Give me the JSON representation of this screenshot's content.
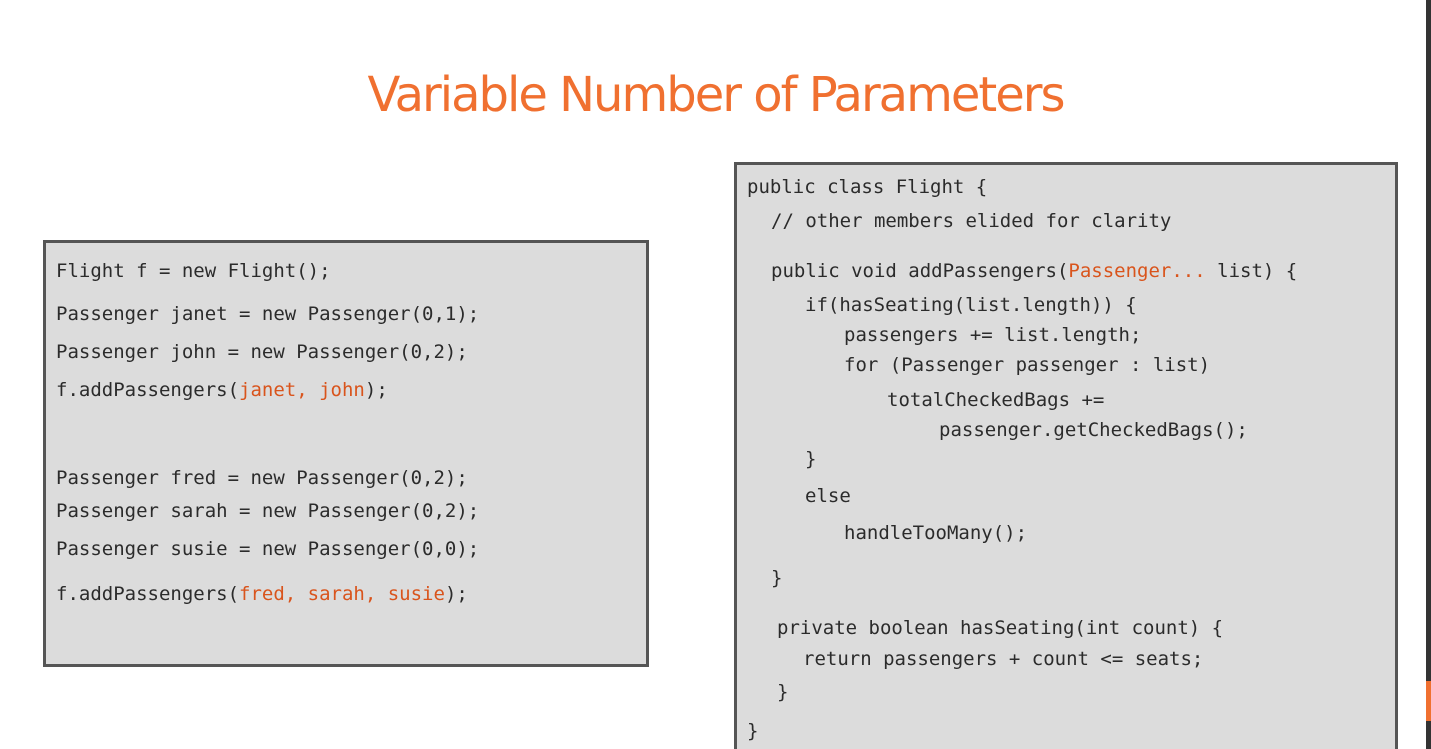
{
  "title": "Variable Number of Parameters",
  "colors": {
    "accent": "#f07030",
    "highlight": "#d9541c",
    "code_text": "#2b2b2b",
    "box_background": "#dcdcdc",
    "box_border": "#555555"
  },
  "left_code": {
    "line_1": "Flight f = new Flight();",
    "line_2": "Passenger janet = new Passenger(0,1);",
    "line_3": "Passenger john = new Passenger(0,2);",
    "line_4_pre": "f.addPassengers(",
    "line_4_args": "janet, john",
    "line_4_post": ");",
    "line_5": "Passenger fred = new Passenger(0,2);",
    "line_6": "Passenger sarah = new Passenger(0,2);",
    "line_7": "Passenger susie = new Passenger(0,0);",
    "line_8_pre": "f.addPassengers(",
    "line_8_args": "fred, sarah, susie",
    "line_8_post": ");"
  },
  "right_code": {
    "line_1": "public class Flight {",
    "line_2": "// other members elided for clarity",
    "line_3_pre": "public void addPassengers(",
    "line_3_param": "Passenger...",
    "line_3_post": " list) {",
    "line_4": "if(hasSeating(list.length)) {",
    "line_5": "passengers += list.length;",
    "line_6": "for (Passenger passenger : list)",
    "line_7": "totalCheckedBags +=",
    "line_8": "passenger.getCheckedBags();",
    "line_9": "}",
    "line_10": "else",
    "line_11": "handleTooMany();",
    "line_12": "}",
    "line_13": "private boolean hasSeating(int count) {",
    "line_14": "return passengers + count <= seats;",
    "line_15": "}",
    "line_16": "}"
  }
}
